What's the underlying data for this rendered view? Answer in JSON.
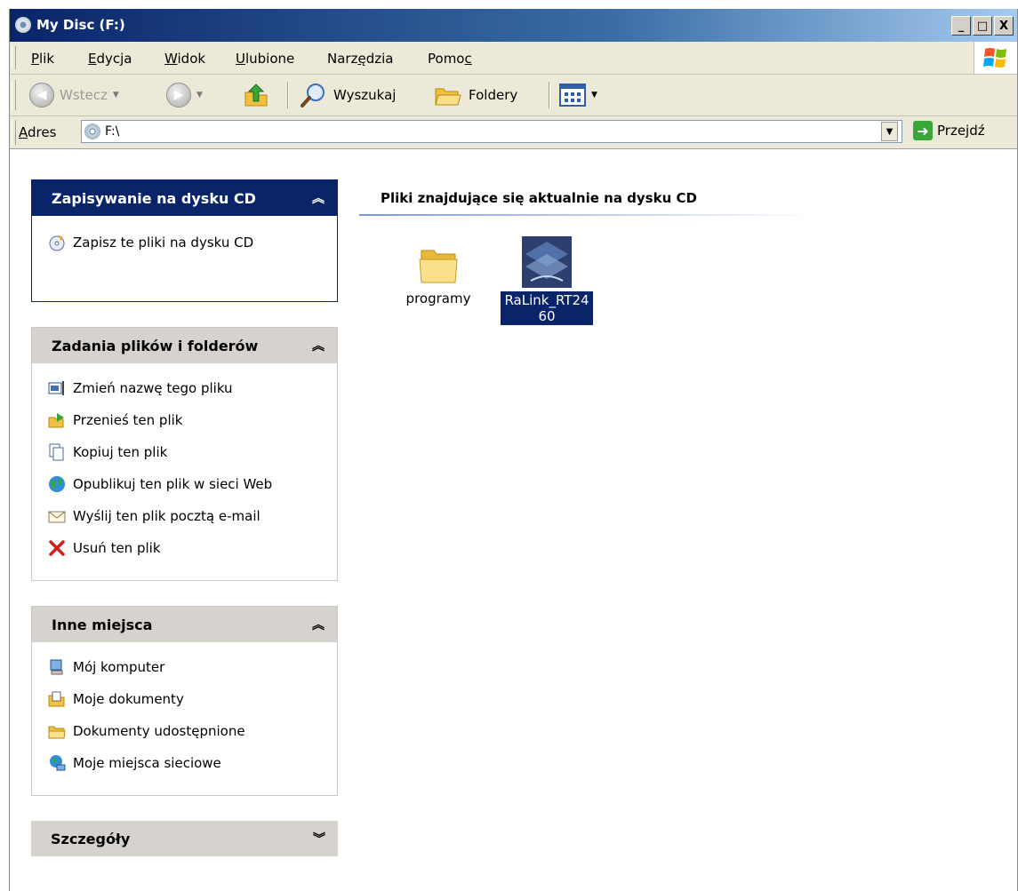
{
  "window": {
    "title": "My Disc (F:)"
  },
  "caption_buttons": {
    "minimize": "_",
    "maximize": "□",
    "close": "X"
  },
  "menu": [
    {
      "label_u": "P",
      "label_rest": "lik"
    },
    {
      "label_u": "E",
      "label_rest": "dycja"
    },
    {
      "label_u": "W",
      "label_rest": "idok"
    },
    {
      "label_u": "U",
      "label_rest": "lubione"
    },
    {
      "label_pre": "Narz",
      "label_u": "ę",
      "label_rest": "dzia"
    },
    {
      "label_pre": "Pomo",
      "label_u": "c",
      "label_rest": ""
    }
  ],
  "toolbar": {
    "back": "Wstecz",
    "search": "Wyszukaj",
    "folders": "Foldery"
  },
  "address": {
    "label_u": "A",
    "label_rest": "dres",
    "value": "F:\\",
    "go": "Przejdź"
  },
  "sidebar": {
    "cd_panel": {
      "title": "Zapisywanie na dysku CD",
      "items": [
        "Zapisz te pliki na dysku CD"
      ]
    },
    "tasks_panel": {
      "title": "Zadania plików i folderów",
      "items": [
        "Zmień nazwę tego pliku",
        "Przenieś ten plik",
        "Kopiuj ten plik",
        "Opublikuj ten plik w sieci Web",
        "Wyślij ten plik pocztą e-mail",
        "Usuń ten plik"
      ]
    },
    "places_panel": {
      "title": "Inne miejsca",
      "items": [
        "Mój komputer",
        "Moje dokumenty",
        "Dokumenty udostępnione",
        "Moje miejsca sieciowe"
      ]
    },
    "details_panel": {
      "title": "Szczegóły"
    }
  },
  "main": {
    "heading": "Pliki znajdujące się aktualnie na dysku CD",
    "files": [
      {
        "name": "programy",
        "type": "folder-icon",
        "selected": false
      },
      {
        "name": "RaLink_RT2460",
        "type": "application-icon",
        "selected": true
      }
    ]
  },
  "colors": {
    "selection": "#0a246a",
    "panel_header": "#d6d3ce",
    "toolbar_bg": "#ece9d8"
  }
}
